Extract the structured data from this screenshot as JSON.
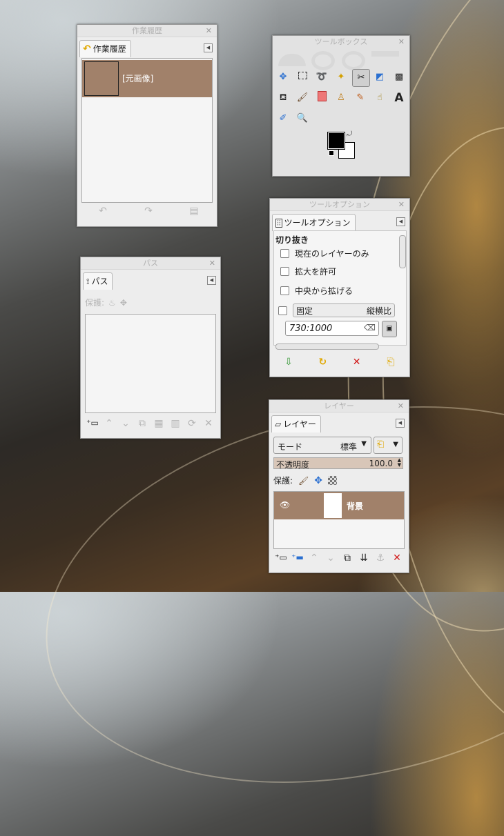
{
  "history": {
    "title": "作業履歴",
    "tab_label": "作業履歴",
    "items": [
      {
        "label": "[元画像]"
      }
    ],
    "buttons": [
      "undo-icon",
      "redo-icon",
      "clear-history-icon"
    ]
  },
  "toolbox": {
    "title": "ツールボックス",
    "tools": [
      "move",
      "rect-select",
      "lasso",
      "fuzzy-select",
      "crop",
      "transform",
      "paths-grid",
      "bucket",
      "paintbrush",
      "eraser",
      "clone",
      "heal",
      "smudge",
      "text",
      "color-picker",
      "zoom"
    ]
  },
  "tool_options": {
    "title": "ツールオプション",
    "tab_label": "ツールオプション",
    "tool_name": "切り抜き",
    "options": [
      {
        "label": "現在のレイヤーのみ"
      },
      {
        "label": "拡大を許可"
      },
      {
        "label": "中央から拡げる"
      }
    ],
    "fixed_label": "固定",
    "fixed_mode": "縦横比",
    "ratio_value": "730:1000"
  },
  "paths": {
    "title": "パス",
    "tab_label": "パス",
    "lock_label": "保護:"
  },
  "layers": {
    "title": "レイヤー",
    "tab_label": "レイヤー",
    "mode_label": "モード",
    "mode_value": "標準",
    "opacity_label": "不透明度",
    "opacity_value": "100.0",
    "lock_label": "保護:",
    "items": [
      {
        "name": "背景"
      }
    ]
  },
  "colors": {
    "brown": "#a1816a",
    "accent": "#e0a800",
    "red": "#d11a1a",
    "blue": "#2a6fd0"
  }
}
